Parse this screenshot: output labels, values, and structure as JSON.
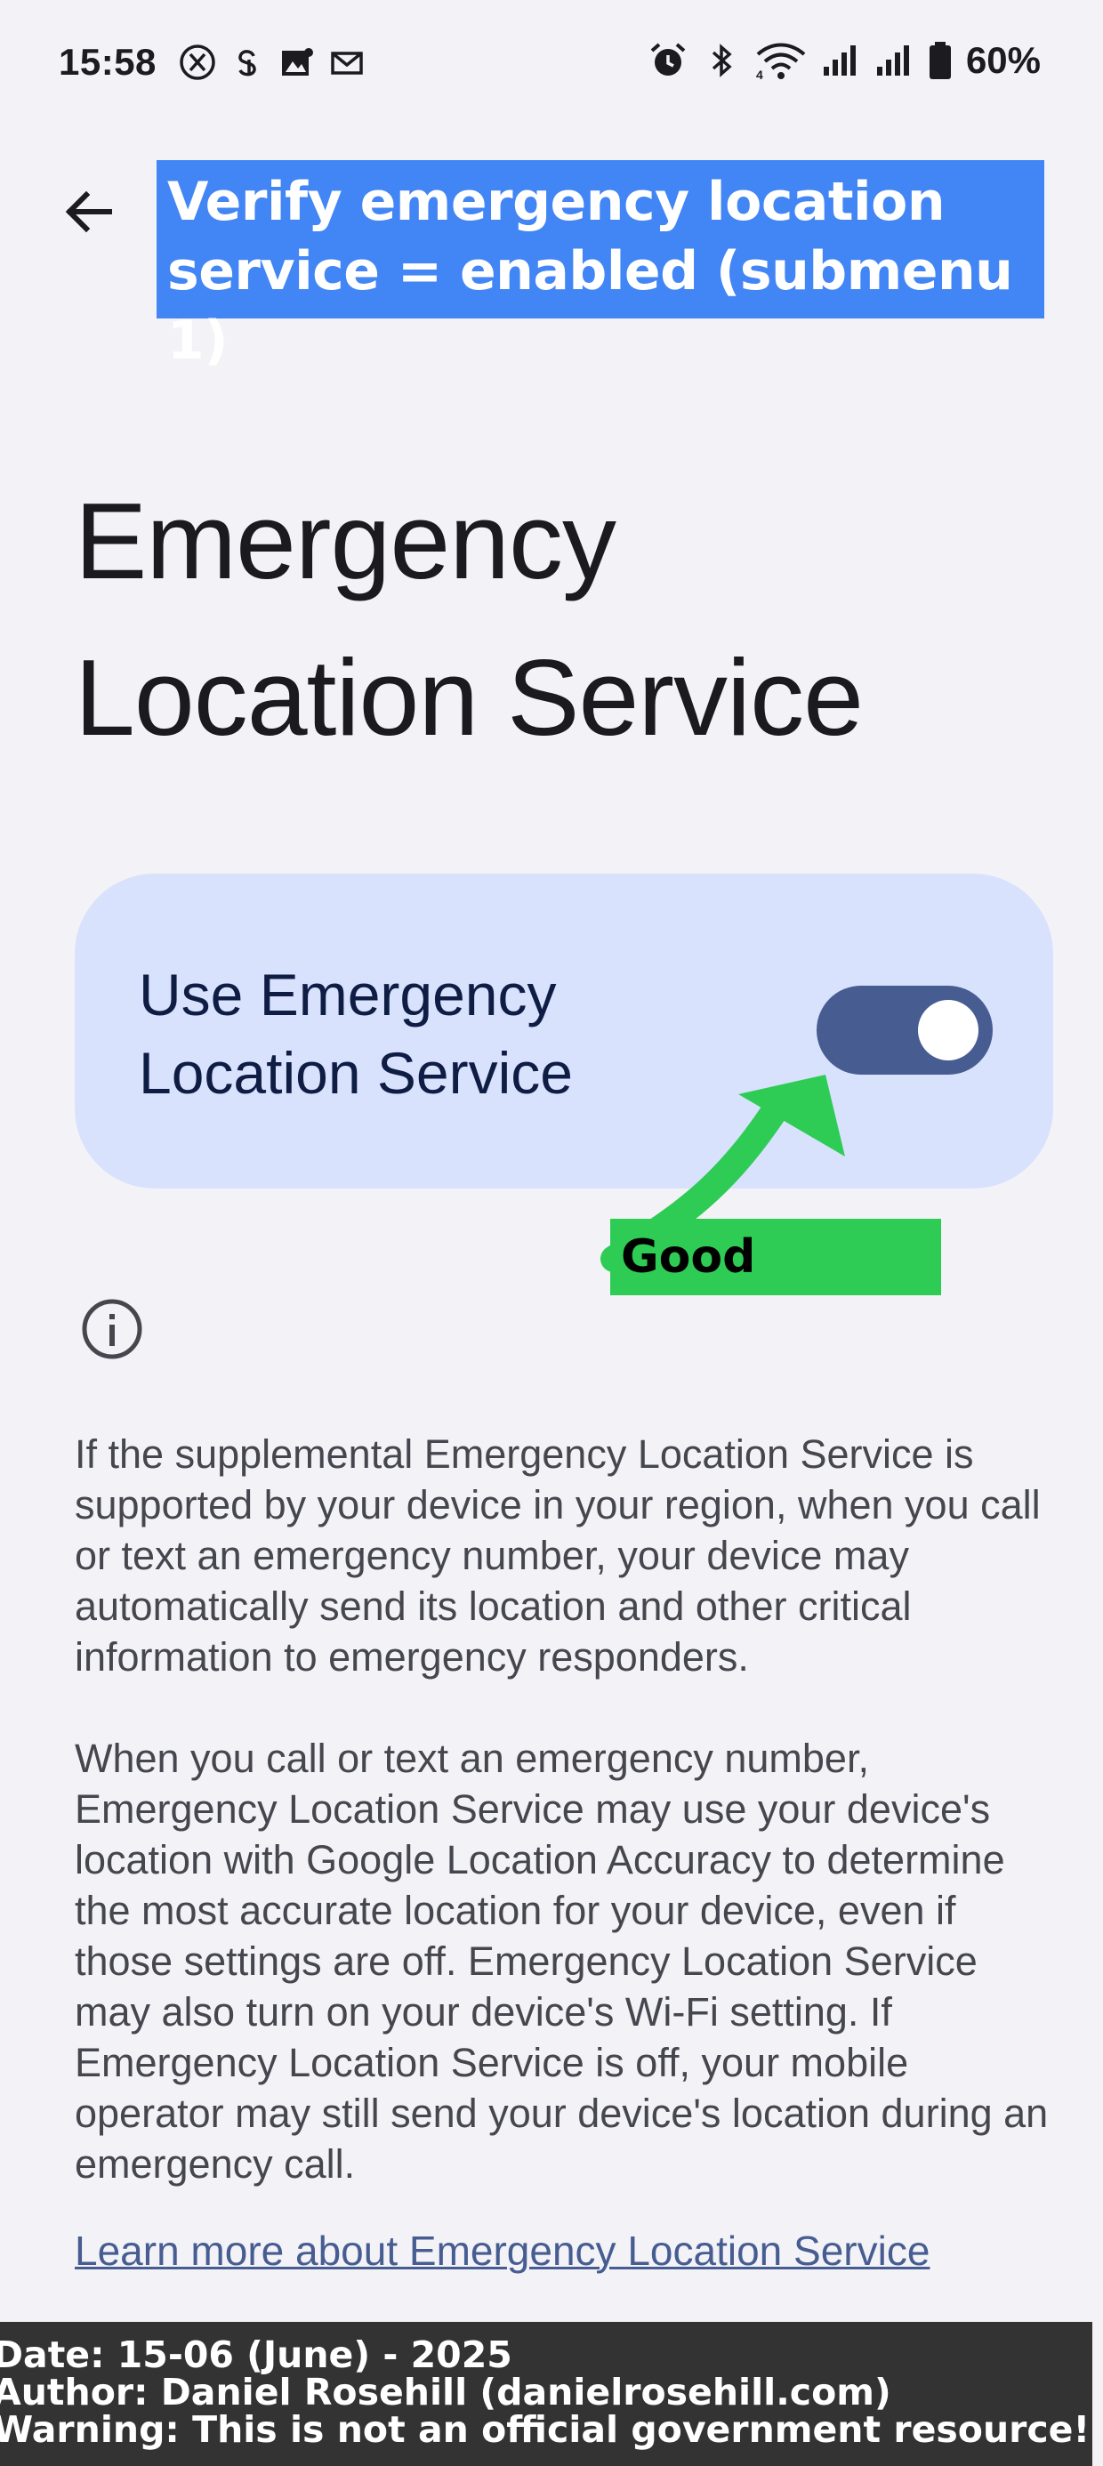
{
  "status_bar": {
    "time": "15:58",
    "left_icons": [
      "x-app-icon",
      "threads-app-icon",
      "photos-icon",
      "mail-icon"
    ],
    "right_icons": [
      "alarm-icon",
      "bluetooth-icon",
      "wifi-icon",
      "signal-icon",
      "signal-icon-2",
      "battery-icon"
    ],
    "battery_percent": "60%"
  },
  "header": {
    "back_icon": "arrow-back-icon",
    "annotation_text": "Verify emergency location service = enabled (submenu 1)",
    "annotation_color": "#4285f4"
  },
  "page": {
    "title": "Emergency Location Service"
  },
  "toggle_card": {
    "label": "Use Emergency Location Service",
    "enabled": true,
    "card_color": "#d9e2fd",
    "switch_color": "#475d92"
  },
  "annotation": {
    "good_label": "Good",
    "arrow_color": "#2ecc55",
    "label_color": "#2ecc55"
  },
  "description": {
    "info_icon": "info-icon",
    "paragraph_1": "If the supplemental Emergency Location Service is supported by your device in your region, when you call or text an emergency number, your device may automatically send its location and other critical information to emergency responders.",
    "paragraph_2": "When you call or text an emergency number, Emergency Location Service may use your device's location with Google Location Accuracy to determine the most accurate location for your device, even if those settings are off. Emergency Location Service may also turn on your device's Wi-Fi setting. If Emergency Location Service is off, your mobile operator may still send your device's location during an emergency call.",
    "learn_more": "Learn more about Emergency Location Service"
  },
  "footer": {
    "date_line": "Date: 15-06 (June) - 2025",
    "author_line": "Author: Daniel Rosehill (danielrosehill.com)",
    "warning_line": "Warning: This is not an official government resource!"
  }
}
